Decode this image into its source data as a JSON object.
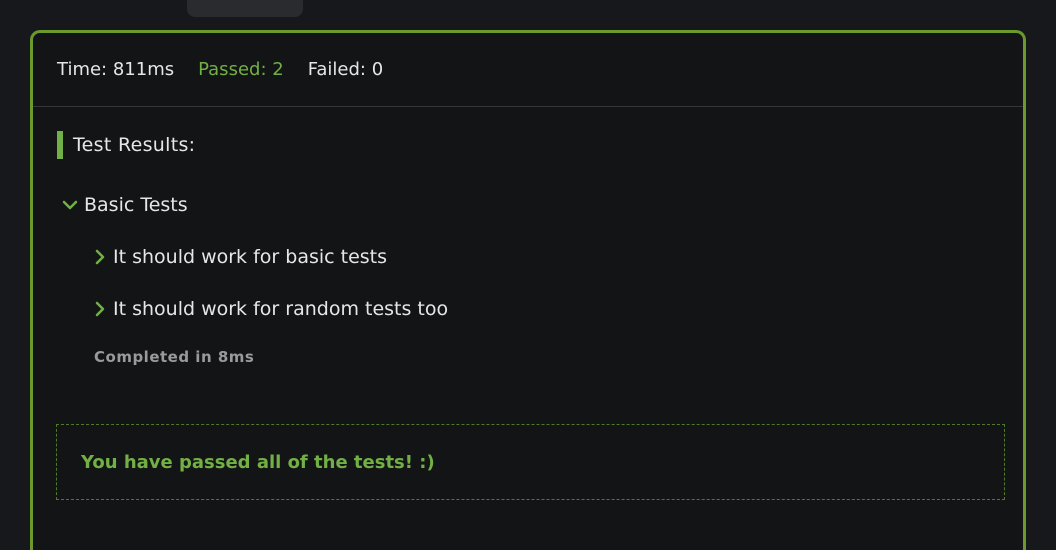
{
  "summary": {
    "time": "Time: 811ms",
    "passed": "Passed: 2",
    "failed": "Failed: 0"
  },
  "results": {
    "heading": "Test Results:",
    "group": {
      "label": "Basic Tests",
      "items": [
        {
          "label": "It should work for basic tests"
        },
        {
          "label": "It should work for random tests too"
        }
      ],
      "completed": "Completed in 8ms"
    }
  },
  "success_message": "You have passed all of the tests! :)",
  "colors": {
    "accent": "#72b045",
    "panel_border": "#6a9a2c",
    "background": "#17181b",
    "panel_background": "#131416"
  },
  "icons": {
    "group_toggle": "chevron-down-icon",
    "item_toggle": "chevron-right-icon"
  }
}
